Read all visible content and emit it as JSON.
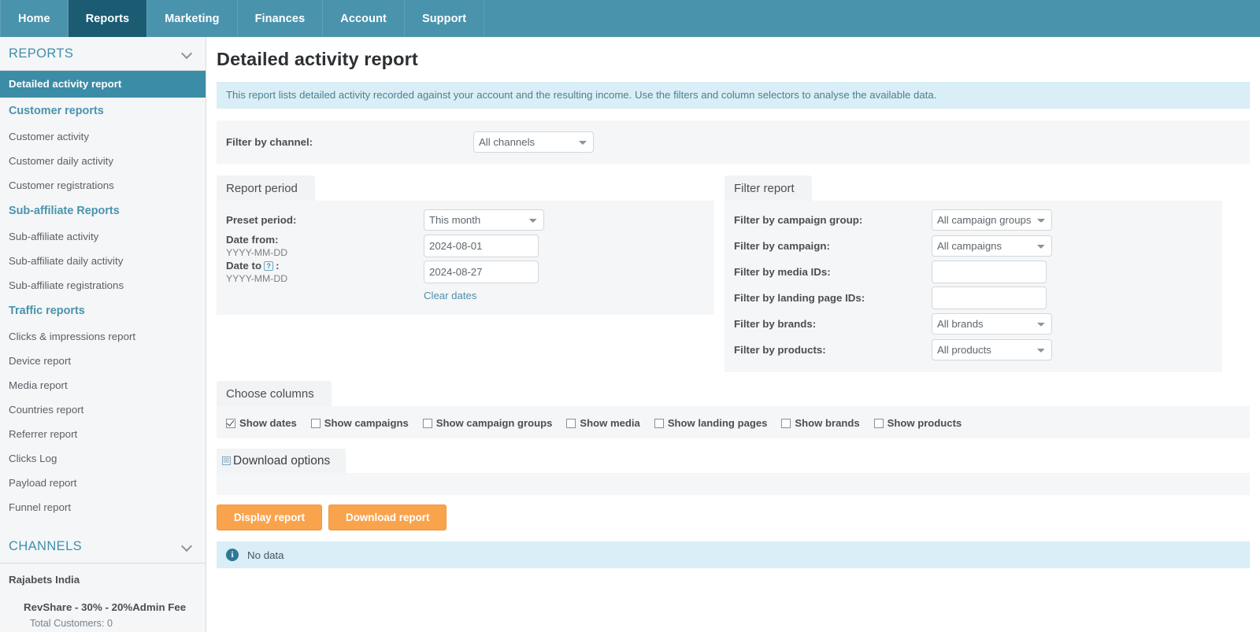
{
  "nav": {
    "tabs": [
      {
        "label": "Home",
        "active": false
      },
      {
        "label": "Reports",
        "active": true
      },
      {
        "label": "Marketing",
        "active": false
      },
      {
        "label": "Finances",
        "active": false
      },
      {
        "label": "Account",
        "active": false
      },
      {
        "label": "Support",
        "active": false
      }
    ],
    "active_color": "#1b5c73",
    "bar_color": "#4a93ad"
  },
  "sidebar": {
    "groups": [
      {
        "title": "REPORTS",
        "chevron": "chevron-down-icon"
      },
      {
        "title": "CHANNELS",
        "chevron": "chevron-down-icon"
      }
    ],
    "reports_items": [
      {
        "label": "Detailed activity report",
        "type": "active"
      },
      {
        "label": "Customer reports",
        "type": "section"
      },
      {
        "label": "Customer activity",
        "type": "item"
      },
      {
        "label": "Customer daily activity",
        "type": "item"
      },
      {
        "label": "Customer registrations",
        "type": "item"
      },
      {
        "label": "Sub-affiliate Reports",
        "type": "section"
      },
      {
        "label": "Sub-affiliate activity",
        "type": "item"
      },
      {
        "label": "Sub-affiliate daily activity",
        "type": "item"
      },
      {
        "label": "Sub-affiliate registrations",
        "type": "item"
      },
      {
        "label": "Traffic reports",
        "type": "section"
      },
      {
        "label": "Clicks & impressions report",
        "type": "item"
      },
      {
        "label": "Device report",
        "type": "item"
      },
      {
        "label": "Media report",
        "type": "item"
      },
      {
        "label": "Countries report",
        "type": "item"
      },
      {
        "label": "Referrer report",
        "type": "item"
      },
      {
        "label": "Clicks Log",
        "type": "item"
      },
      {
        "label": "Payload report",
        "type": "item"
      },
      {
        "label": "Funnel report",
        "type": "item"
      }
    ],
    "channel": {
      "name": "Rajabets India",
      "plan": "RevShare - 30% - 20%Admin Fee",
      "stat": "Total Customers: 0"
    },
    "active_color": "#3b8ca7",
    "section_color": "#4a93ad"
  },
  "main": {
    "title": "Detailed activity report",
    "info_banner": "This report lists detailed activity recorded against your account and the resulting income. Use the filters and column selectors to analyse the available data.",
    "channel_filter": {
      "label": "Filter by channel:",
      "value": "All channels",
      "options": [
        "All channels"
      ]
    },
    "report_period": {
      "heading": "Report period",
      "preset_label": "Preset period:",
      "preset_value": "This month",
      "preset_options": [
        "This month"
      ],
      "date_from_label": "Date from:",
      "date_from_hint": "YYYY-MM-DD",
      "date_from_value": "2024-08-01",
      "date_to_label": "Date to",
      "date_to_suffix": ":",
      "date_to_hint": "YYYY-MM-DD",
      "date_to_value": "2024-08-27",
      "date_to_help_icon": "question-mark-help-icon",
      "clear_dates_label": "Clear dates"
    },
    "filter_report": {
      "heading": "Filter report",
      "rows": [
        {
          "label": "Filter by campaign group:",
          "kind": "select",
          "value": "All campaign groups"
        },
        {
          "label": "Filter by campaign:",
          "kind": "select",
          "value": "All campaigns"
        },
        {
          "label": "Filter by media IDs:",
          "kind": "input",
          "value": "",
          "placeholder": ""
        },
        {
          "label": "Filter by landing page IDs:",
          "kind": "input",
          "value": "",
          "placeholder": ""
        },
        {
          "label": "Filter by brands:",
          "kind": "select",
          "value": "All brands"
        },
        {
          "label": "Filter by products:",
          "kind": "select",
          "value": "All products"
        }
      ]
    },
    "choose_columns": {
      "heading": "Choose columns",
      "items": [
        {
          "label": "Show dates",
          "checked": true
        },
        {
          "label": "Show campaigns",
          "checked": false
        },
        {
          "label": "Show campaign groups",
          "checked": false
        },
        {
          "label": "Show media",
          "checked": false
        },
        {
          "label": "Show landing pages",
          "checked": false
        },
        {
          "label": "Show brands",
          "checked": false
        },
        {
          "label": "Show products",
          "checked": false
        }
      ]
    },
    "download_options": {
      "heading": "Download options",
      "glyph_icon": "checkbox-placeholder-icon"
    },
    "buttons": [
      {
        "label": "Display report",
        "name": "display-report-button"
      },
      {
        "label": "Download report",
        "name": "download-report-button"
      }
    ],
    "button_color": "#f9a44c",
    "status": {
      "icon": "info-circle-icon",
      "text": "No data"
    }
  }
}
